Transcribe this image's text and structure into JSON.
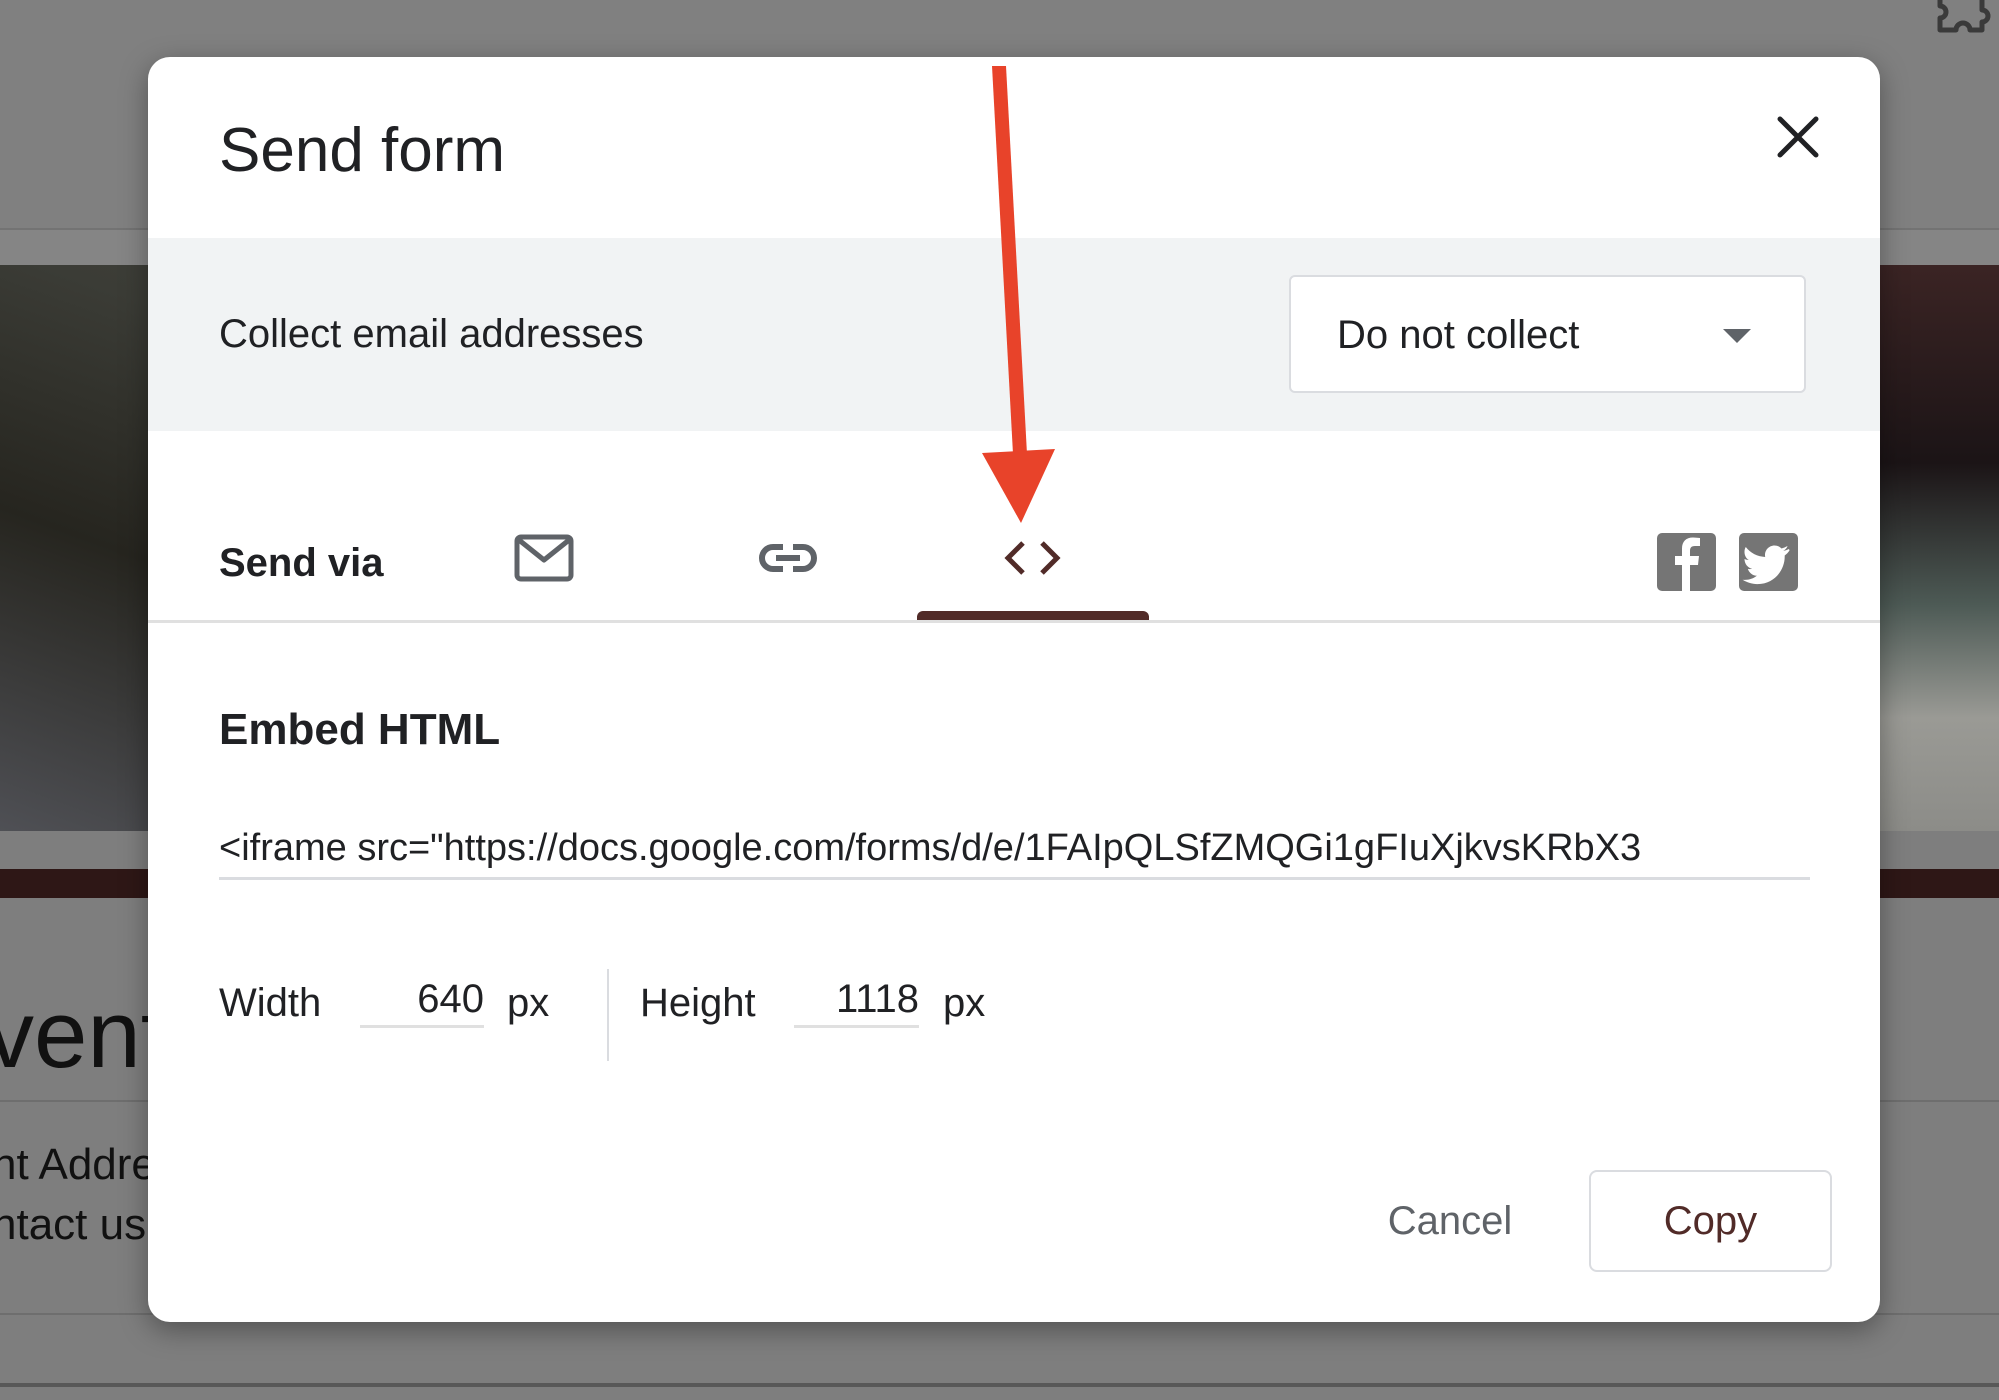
{
  "background_page": {
    "title_fragment": "vent",
    "address_fragment": "nt Addre",
    "contact_fragment": "ntact us"
  },
  "dialog": {
    "title": "Send form",
    "close_icon": "close-icon",
    "collect_email": {
      "label": "Collect email addresses",
      "selected": "Do not collect"
    },
    "send_via": {
      "label": "Send via",
      "tabs": [
        {
          "icon": "email-icon",
          "active": false
        },
        {
          "icon": "link-icon",
          "active": false
        },
        {
          "icon": "embed-code-icon",
          "active": true
        }
      ],
      "share": [
        {
          "icon": "facebook-icon"
        },
        {
          "icon": "twitter-icon"
        }
      ]
    },
    "embed": {
      "heading": "Embed HTML",
      "code": "<iframe src=\"https://docs.google.com/forms/d/e/1FAIpQLSfZMQGi1gFIuXjkvsKRbX3",
      "width_label": "Width",
      "width_value": "640",
      "width_unit": "px",
      "height_label": "Height",
      "height_value": "1118",
      "height_unit": "px"
    },
    "actions": {
      "cancel": "Cancel",
      "copy": "Copy"
    }
  },
  "colors": {
    "accent": "#512b28",
    "annotation_arrow": "#e8432a",
    "icon_gray": "#5f6368",
    "section_bg": "#f1f3f4"
  }
}
